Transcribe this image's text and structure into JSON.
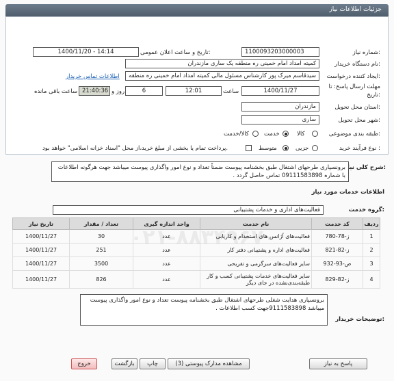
{
  "header": {
    "title": "جزئیات اطلاعات نیاز"
  },
  "fields": {
    "need_number_label": "شماره نیاز:",
    "need_number": "1100093203000003",
    "announce_label": "تاریخ و ساعت اعلان عمومی:",
    "announce_date": "1400/11/20 - 14:14",
    "buyer_label": "نام دستگاه خریدار:",
    "buyer": "کمیته امداد امام خمینی  ره  منطقه یک ساری   مازندران",
    "creator_label": "ایجاد کننده درخواست:",
    "creator": "سیدقاسم میرک پور کارشناس مسئول مالی کمیته امداد امام خمینی  ره  منطقه",
    "contact_link": "اطلاعات تماس خریدار",
    "deadline_label": "مهلت ارسال پاسخ: تا",
    "deadline_date_label": "تاریخ:",
    "deadline_date": "1400/11/27",
    "time_label": "ساعت",
    "deadline_time": "12:01",
    "days": "6",
    "days_label": "روز و",
    "remaining_time": "21:40:36",
    "remaining_label": "ساعت باقی مانده",
    "province_label": "استان محل تحویل:",
    "province": "مازندران",
    "city_label": "شهر محل تحویل:",
    "city": "ساری",
    "category_label": "طبقه بندی موضوعی:",
    "cat_goods": "کالا",
    "cat_service": "خدمت",
    "cat_goods_service": "کالا/خدمت",
    "process_label": "نوع فرآیند خرید :",
    "proc_small": "جزیی",
    "proc_medium": "متوسط",
    "payment_note": "پرداخت تمام یا بخشی از مبلغ خرید،از محل \"اسناد خزانه اسلامی\" خواهد بود."
  },
  "summary": {
    "label": "شرح کلی نیاز:",
    "text": "برونسپاری  طرحهای اشتغال طبق بخشنامه پیوست ضمناً تعداد و نوع امور واگذاری پیوست میباشد  جهت هرگونه اطلاعات با شماره 09111583898 تماس حاصل گردد ."
  },
  "services": {
    "section_title": "اطلاعات خدمات مورد نیاز",
    "group_label": "گروه خدمت:",
    "group": "فعالیت‌های اداری و خدمات پشتیبانی"
  },
  "table": {
    "headers": [
      "ردیف",
      "کد خدمت",
      "نام خدمت",
      "واحد اندازه گیری",
      "تعداد / مقدار",
      "تاریخ نیاز"
    ],
    "rows": [
      [
        "1",
        "ز-78-780",
        "فعالیت‌های آژانس های استخدام و کاریابی",
        "عدد",
        "30",
        "1400/11/27"
      ],
      [
        "2",
        "ز-82-821",
        "فعالیت‌های اداره و پشتیبانی دفتر کار",
        "عدد",
        "251",
        "1400/11/27"
      ],
      [
        "3",
        "ص-93-932",
        "سایر فعالیت‌های سرگرمی و تفریحی",
        "عدد",
        "3500",
        "1400/11/27"
      ],
      [
        "4",
        "ز-82-829",
        "سایر فعالیت‌های خدمات پشتیبانی کسب و کار طبقه‌بندی‌نشده در جای دیگر",
        "عدد",
        "826",
        "1400/11/27"
      ]
    ]
  },
  "buyer_notes": {
    "label": "توضیحات خریدار:",
    "text": "برونسپاری هدایت شغلی طرحهای اشتغال طبق بخشنامه پیوست تعداد و نوع امور واگذاری پیوست میباشد 9111583898جهت کسب اطلاعات ."
  },
  "buttons": {
    "reply": "پاسخ به نیاز",
    "docs": "مشاهده مدارک پیوستی (3)",
    "print": "چاپ",
    "back": "بازگشت",
    "exit": "خروج"
  },
  "colors": {
    "titlebar": "#5d6b7a",
    "link": "#1a5fb4",
    "exit_button": "#f3bcbc"
  }
}
